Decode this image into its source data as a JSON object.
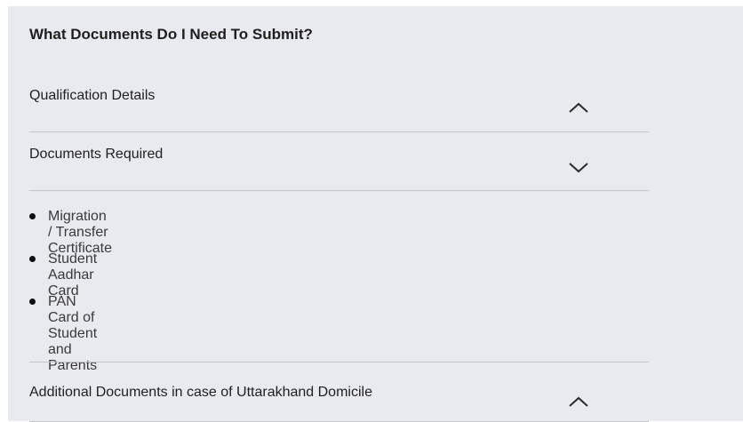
{
  "section": {
    "heading": "What Documents Do I Need To Submit?"
  },
  "accordion": [
    {
      "label": "Qualification Details",
      "state": "collapsed",
      "chevron_icon": "chevron-up-icon"
    },
    {
      "label": "Documents Required",
      "state": "expanded",
      "chevron_icon": "chevron-down-icon"
    },
    {
      "label": "Additional Documents in case of Uttarakhand Domicile",
      "state": "collapsed",
      "chevron_icon": "chevron-up-icon"
    }
  ],
  "documents_required": {
    "items": [
      "Migration / Transfer Certificate",
      "Student Aadhar Card",
      "PAN Card of Student and Parents"
    ]
  },
  "colors": {
    "panel_background": "#e8eaf0",
    "divider": "#c2c4c8",
    "text": "#1f1f1f",
    "list_text": "#3a3a3a"
  }
}
